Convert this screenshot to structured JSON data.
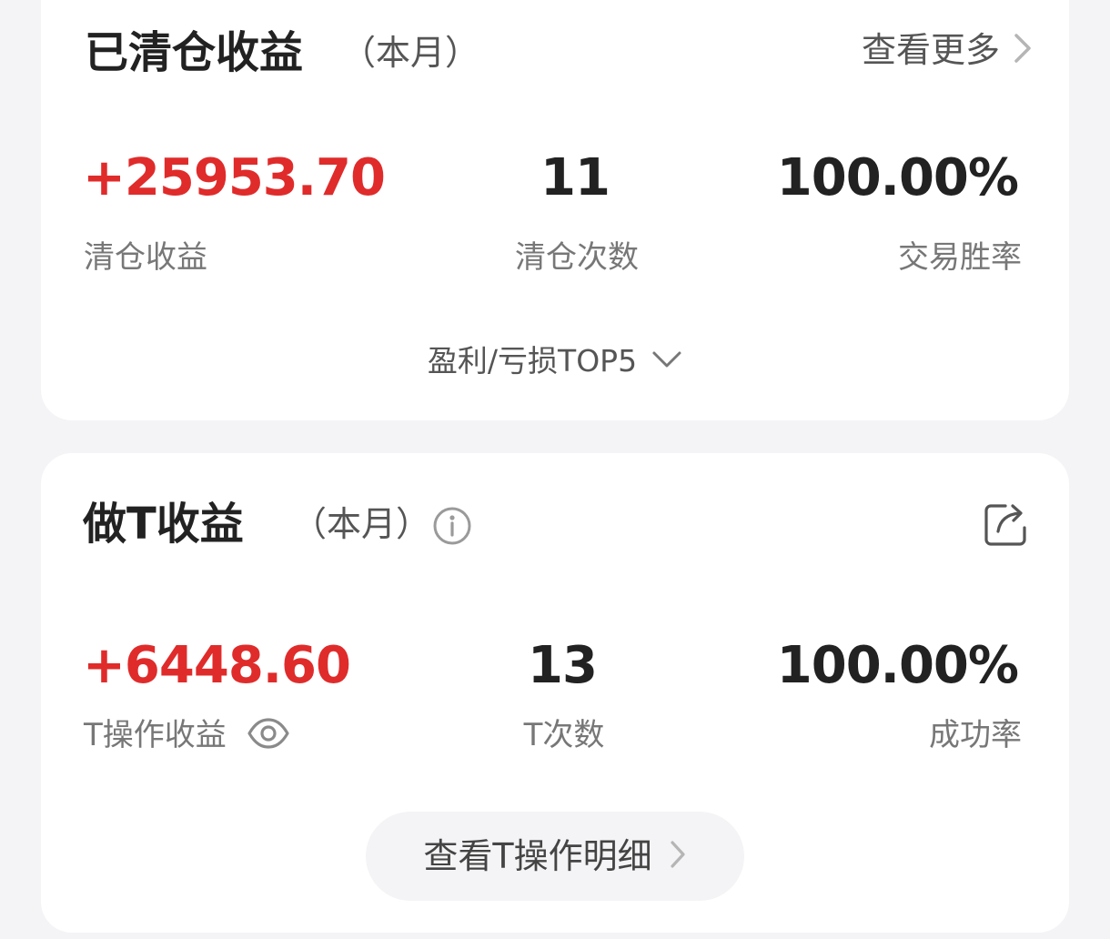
{
  "cleared": {
    "title": "已清仓收益",
    "period": "（本月）",
    "more_label": "查看更多",
    "profit_value": "+25953.70",
    "profit_label": "清仓收益",
    "count_value": "11",
    "count_label": "清仓次数",
    "winrate_value": "100.00%",
    "winrate_label": "交易胜率",
    "top5_label": "盈利/亏损TOP5"
  },
  "t_trade": {
    "title": "做T收益",
    "period": "（本月）",
    "profit_value": "+6448.60",
    "profit_label": "T操作收益",
    "count_value": "13",
    "count_label": "T次数",
    "success_value": "100.00%",
    "success_label": "成功率",
    "detail_button": "查看T操作明细"
  },
  "colors": {
    "profit_red": "#e02b2b",
    "page_background": "#f4f4f6",
    "card_background": "#ffffff"
  },
  "icons": [
    "chevron-right-icon",
    "chevron-down-icon",
    "info-icon",
    "share-icon",
    "eye-icon"
  ]
}
